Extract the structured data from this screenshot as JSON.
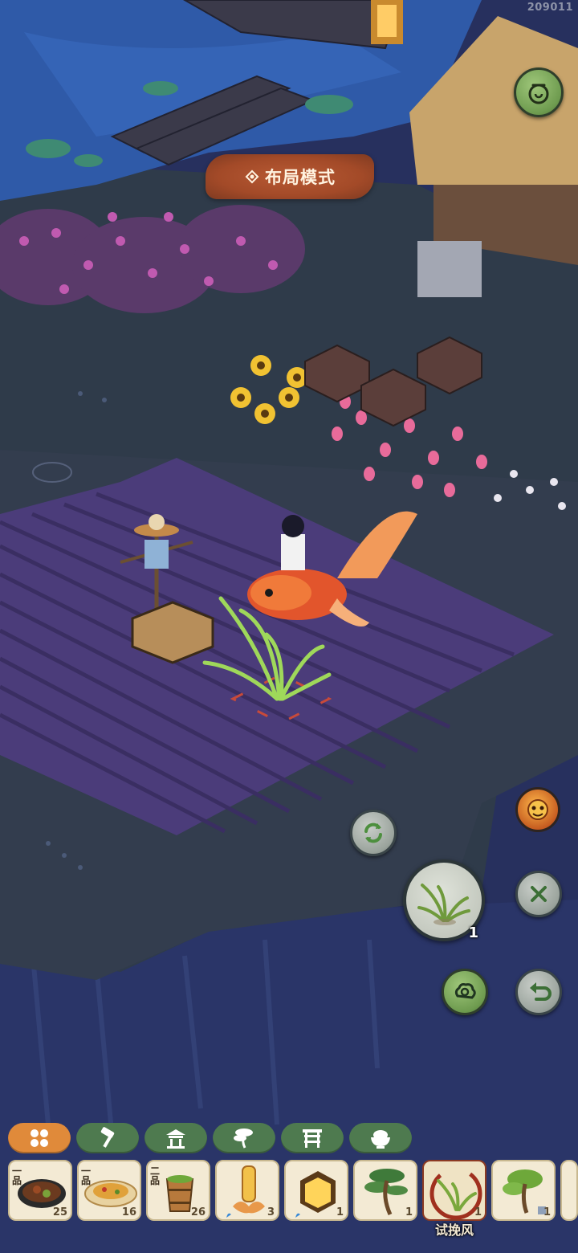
{
  "build_id": "209011",
  "layout_mode": {
    "label": "布局模式",
    "icon": "flower-diamond-icon"
  },
  "top_right_button": {
    "icon": "pot-refresh-icon"
  },
  "side_controls": {
    "rotate": {
      "icon": "rotate-arrows-icon"
    },
    "guardian": {
      "icon": "lion-mask-icon"
    },
    "selected_item": {
      "icon": "grass-plant-icon",
      "count": "1"
    },
    "cancel": {
      "icon": "close-icon"
    },
    "cloud": {
      "icon": "cloud-swirl-icon"
    },
    "undo": {
      "icon": "undo-arrow-icon"
    }
  },
  "category_tabs": [
    {
      "icon": "grid-four-icon",
      "active": true
    },
    {
      "icon": "hammer-icon",
      "active": false
    },
    {
      "icon": "pavilion-icon",
      "active": false
    },
    {
      "icon": "bonsai-tree-icon",
      "active": false
    },
    {
      "icon": "gate-icon",
      "active": false
    },
    {
      "icon": "rice-bowl-icon",
      "active": false
    }
  ],
  "inventory": [
    {
      "grade": "一品",
      "count": "25",
      "icon": "dish-plate-icon"
    },
    {
      "grade": "一品",
      "count": "16",
      "icon": "noodle-plate-icon"
    },
    {
      "grade": "二品",
      "count": "26",
      "icon": "wooden-bucket-icon"
    },
    {
      "grade": "",
      "count": "3",
      "icon": "lantern-lotus-icon"
    },
    {
      "grade": "",
      "count": "1",
      "icon": "square-lantern-icon"
    },
    {
      "grade": "",
      "count": "1",
      "icon": "pine-bonsai-icon"
    },
    {
      "grade": "",
      "count": "1",
      "icon": "grass-plant-icon",
      "name": "试挽风",
      "selected": true
    },
    {
      "grade": "",
      "count": "1",
      "icon": "green-bonsai-icon"
    }
  ],
  "colors": {
    "tab_active": "#e08a3a",
    "tab_inactive": "#4e7a4f",
    "banner": "#a34a28",
    "field": "#4b3c7a"
  }
}
